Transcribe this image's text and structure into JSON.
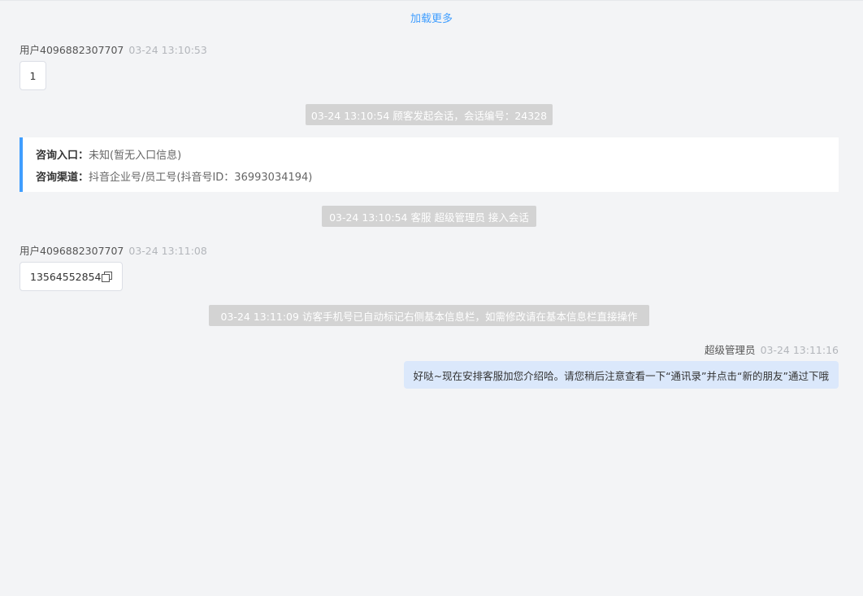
{
  "load_more": "加载更多",
  "messages": [
    {
      "user": "用户4096882307707",
      "time": "03-24 13:10:53",
      "text": "1"
    },
    {
      "user": "用户4096882307707",
      "time": "03-24 13:11:08",
      "text": "13564552854"
    }
  ],
  "system": [
    "03-24 13:10:54 顾客发起会话，会话编号：24328",
    "03-24 13:10:54 客服 超级管理员 接入会话",
    "03-24 13:11:09 访客手机号已自动标记右侧基本信息栏，如需修改请在基本信息栏直接操作"
  ],
  "info": {
    "entry_label": "咨询入口：",
    "entry_value": "未知(暂无入口信息)",
    "channel_label": "咨询渠道：",
    "channel_value": "抖音企业号/员工号(抖音号ID：36993034194)"
  },
  "agent": {
    "name": "超级管理员",
    "time": "03-24 13:11:16",
    "text": "好哒~现在安排客服加您介绍哈。请您稍后注意查看一下“通讯录”并点击“新的朋友”通过下哦"
  },
  "colors": {
    "accent": "#409eff",
    "system_bg": "#d3d3d3",
    "agent_bubble": "#dbe8fb"
  }
}
